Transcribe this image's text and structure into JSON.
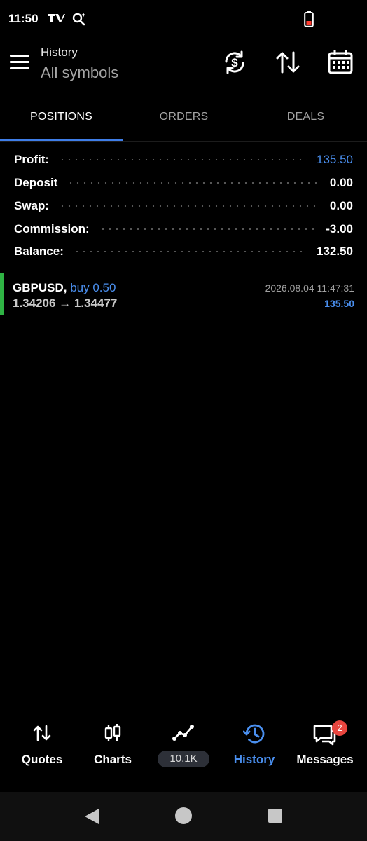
{
  "status_bar": {
    "time": "11:50"
  },
  "header": {
    "title": "History",
    "subtitle": "All symbols"
  },
  "tabs": [
    {
      "label": "POSITIONS",
      "active": true
    },
    {
      "label": "ORDERS",
      "active": false
    },
    {
      "label": "DEALS",
      "active": false
    }
  ],
  "summary": [
    {
      "label": "Profit:",
      "value": "135.50"
    },
    {
      "label": "Deposit",
      "value": "0.00"
    },
    {
      "label": "Swap:",
      "value": "0.00"
    },
    {
      "label": "Commission:",
      "value": "-3.00"
    },
    {
      "label": "Balance:",
      "value": "132.50"
    }
  ],
  "position": {
    "symbol": "GBPUSD,",
    "side": "buy 0.50",
    "prices": "1.34206 → 1.34477",
    "time": "2026.08.04 11:47:31",
    "profit": "135.50"
  },
  "bottom_nav": [
    {
      "label": "Quotes",
      "icon": "quotes-arrows-icon"
    },
    {
      "label": "Charts",
      "icon": "candlestick-icon"
    },
    {
      "label": "10.1K",
      "icon": "trend-line-icon"
    },
    {
      "label": "History",
      "icon": "history-clock-icon",
      "active": true
    },
    {
      "label": "Messages",
      "icon": "chat-icon",
      "badge": "2"
    }
  ],
  "colors": {
    "accent": "#4a8fef",
    "buy_bar": "#2fb344",
    "badge": "#e8463f",
    "background": "#000000"
  }
}
